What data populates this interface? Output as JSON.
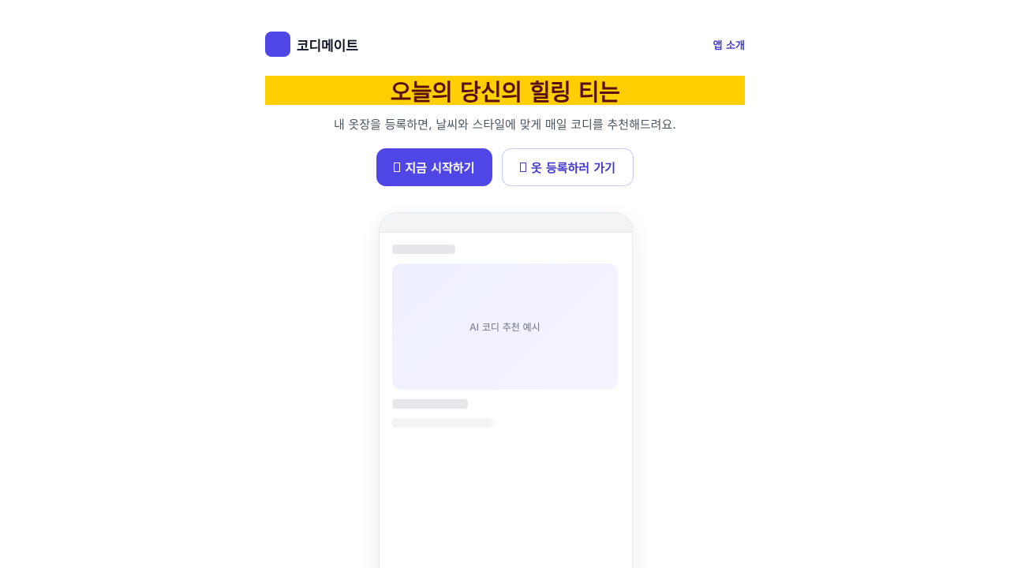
{
  "brand": {
    "name": "코디메이트"
  },
  "nav": {
    "about_label": "앱 소개"
  },
  "hero": {
    "title": "오늘의 당신의 힐링 티는",
    "subtitle": "내 옷장을 등록하면, 날씨와 스타일에 맞게 매일 코디를 추천해드려요."
  },
  "cta": {
    "primary_icon": "placeholder-glyph-icon",
    "primary_label": "지금 시작하기",
    "secondary_icon": "placeholder-glyph-icon",
    "secondary_label": "옷 등록하러 가기"
  },
  "preview": {
    "card_label": "AI 코디 추천 예시"
  },
  "colors": {
    "accent": "#4f46e5",
    "accent_text": "#4338ca",
    "highlight": "#ffcf00",
    "title_text": "#5a1010"
  }
}
